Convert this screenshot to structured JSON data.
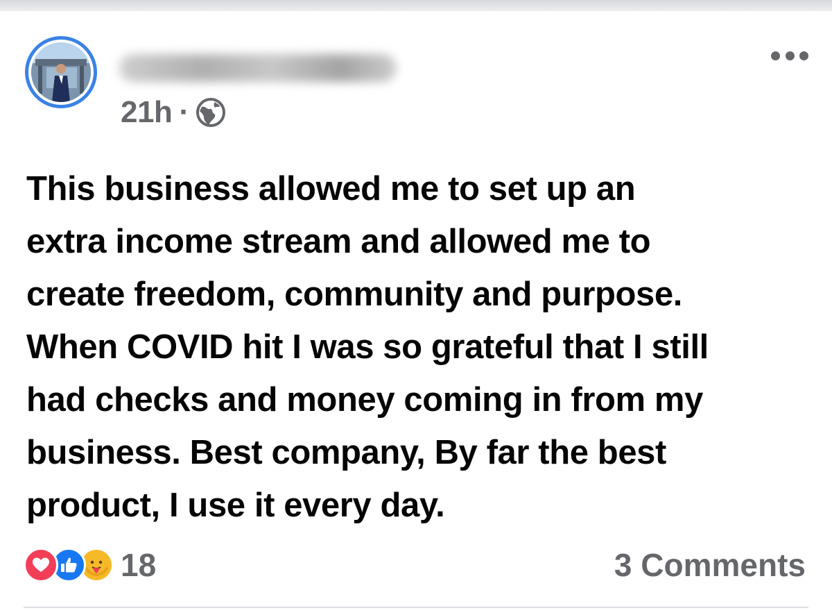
{
  "post": {
    "timestamp": "21h",
    "separator": "·",
    "privacy_icon": "globe-icon",
    "more_icon": "more-options-icon",
    "body": "This business allowed me to set up an\nextra income stream and allowed me to\ncreate freedom, community and purpose.\nWhen  COVID hit I was so grateful that I still\nhad checks and money coming in from my\nbusiness. Best company, By far the best\nproduct, I use it every day.",
    "reactions": {
      "icons": [
        "love-icon",
        "like-icon",
        "care-icon"
      ],
      "count": "18"
    },
    "comments_label": "3 Comments"
  },
  "colors": {
    "avatar_ring": "#3b82e6",
    "body_text": "#050505",
    "secondary_text": "#65676b",
    "love": "#f33e58",
    "like": "#1877f2",
    "care": "#f7b928"
  }
}
